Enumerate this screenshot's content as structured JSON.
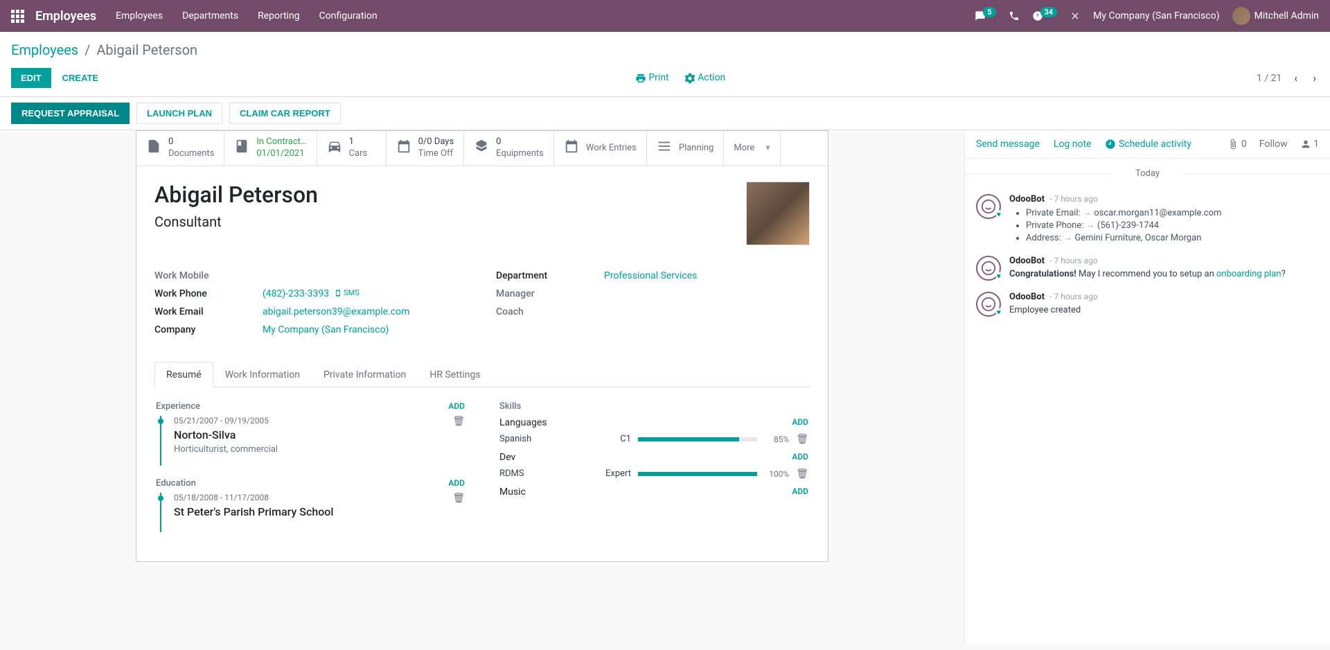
{
  "nav": {
    "brand": "Employees",
    "items": [
      "Employees",
      "Departments",
      "Reporting",
      "Configuration"
    ],
    "msg_badge": "5",
    "clock_badge": "34",
    "company": "My Company (San Francisco)",
    "user": "Mitchell Admin"
  },
  "breadcrumb": {
    "root": "Employees",
    "current": "Abigail Peterson"
  },
  "buttons": {
    "edit": "EDIT",
    "create": "CREATE",
    "print": "Print",
    "action": "Action"
  },
  "pager": {
    "pos": "1 / 21"
  },
  "statusbar": {
    "request": "REQUEST APPRAISAL",
    "launch": "LAUNCH PLAN",
    "claim": "CLAIM CAR REPORT"
  },
  "stats": {
    "documents": {
      "val": "0",
      "label": "Documents"
    },
    "contract": {
      "val": "In Contract…",
      "sub": "01/01/2021"
    },
    "cars": {
      "val": "1",
      "label": "Cars"
    },
    "timeoff": {
      "val": "0/0 Days",
      "label": "Time Off"
    },
    "equip": {
      "val": "0",
      "label": "Equipments"
    },
    "work": "Work Entries",
    "planning": "Planning",
    "more": "More"
  },
  "record": {
    "name": "Abigail Peterson",
    "title": "Consultant",
    "labels": {
      "mobile": "Work Mobile",
      "phone": "Work Phone",
      "email": "Work Email",
      "company": "Company",
      "dept": "Department",
      "manager": "Manager",
      "coach": "Coach"
    },
    "phone": "(482)-233-3393",
    "sms": "SMS",
    "email": "abigail.peterson39@example.com",
    "company": "My Company (San Francisco)",
    "dept": "Professional Services"
  },
  "tabs": [
    "Resumé",
    "Work Information",
    "Private Information",
    "HR Settings"
  ],
  "resume": {
    "add": "ADD",
    "experience": "Experience",
    "education": "Education",
    "exp1": {
      "dates": "05/21/2007 - 09/19/2005",
      "title": "Norton-Silva",
      "sub": "Horticulturist, commercial"
    },
    "edu1": {
      "dates": "05/18/2008 - 11/17/2008",
      "title": "St Peter's Parish Primary School"
    }
  },
  "skills": {
    "h": "Skills",
    "languages": "Languages",
    "dev": "Dev",
    "music": "Music",
    "lang1": {
      "name": "Spanish",
      "level": "C1",
      "pct": "85%"
    },
    "dev1": {
      "name": "RDMS",
      "level": "Expert",
      "pct": "100%"
    }
  },
  "chatter": {
    "send": "Send message",
    "log": "Log note",
    "schedule": "Schedule activity",
    "attach": "0",
    "follow": "Follow",
    "followers": "1",
    "today": "Today",
    "bot": "OdooBot",
    "time": "- 7 hours ago",
    "m1": {
      "pe": "Private Email:",
      "pe_v": "oscar.morgan11@example.com",
      "pp": "Private Phone:",
      "pp_v": "(561)-239-1744",
      "ad": "Address:",
      "ad_v": "Gemini Furniture, Oscar Morgan"
    },
    "m2": {
      "congrats": "Congratulations!",
      "rest": " May I recommend you to setup an ",
      "link": "onboarding plan",
      "q": "?"
    },
    "m3": "Employee created"
  }
}
